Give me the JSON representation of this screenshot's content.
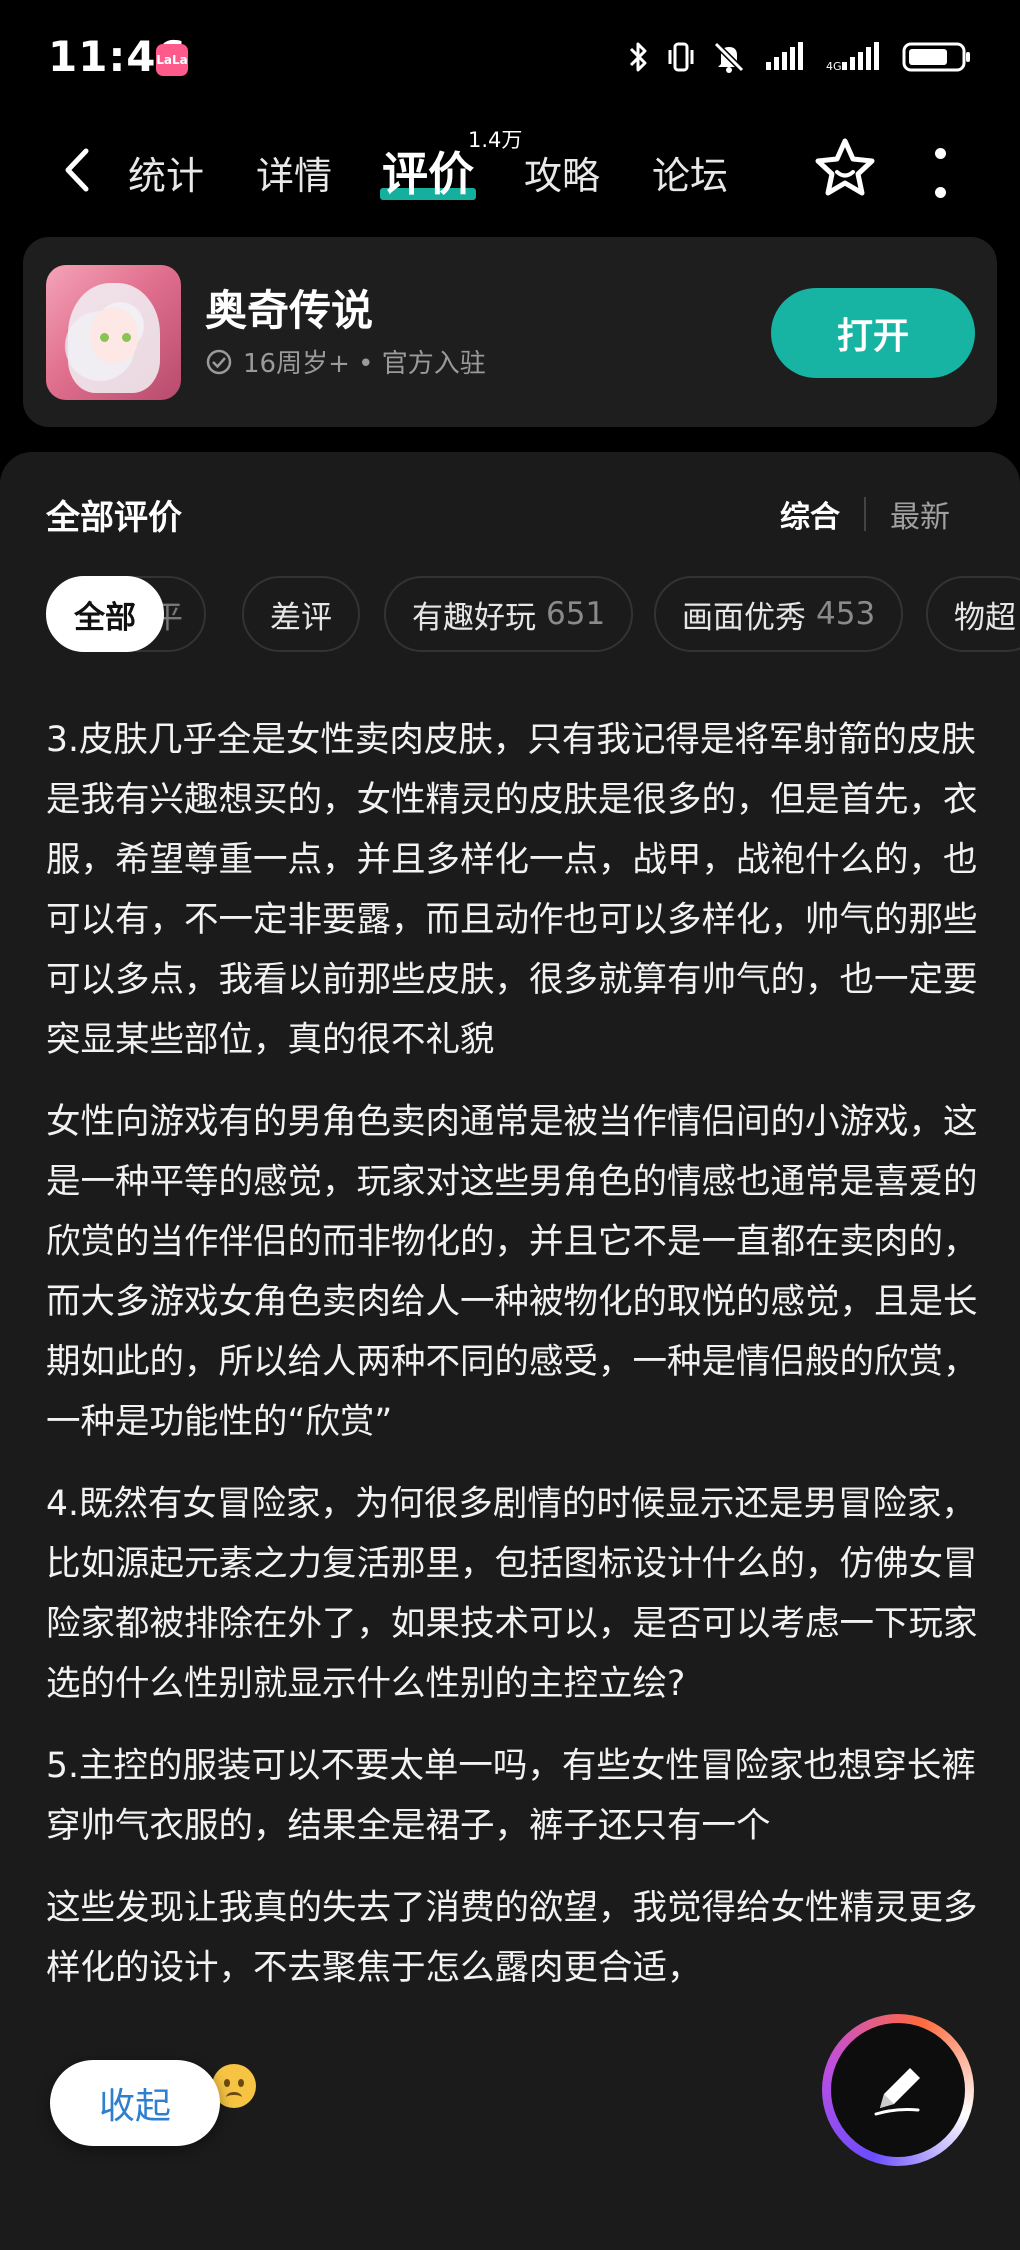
{
  "status_bar": {
    "time": "11:46",
    "app_badge": "LaLa",
    "battery_level": 0.75
  },
  "nav": {
    "tabs": [
      {
        "label": "统计"
      },
      {
        "label": "详情"
      },
      {
        "label": "评价",
        "count": "1.4万"
      },
      {
        "label": "攻略"
      },
      {
        "label": "论坛"
      }
    ],
    "active_tab": "评价",
    "accent": "#17b3a3"
  },
  "game": {
    "name": "奥奇传说",
    "meta": "16周岁+ • 官方入驻",
    "open_label": "打开"
  },
  "reviews": {
    "title": "全部评价",
    "sort": {
      "active": "综合",
      "other": "最新"
    },
    "chips": [
      {
        "label": "全部",
        "count": ""
      },
      {
        "label": "平",
        "count": ""
      },
      {
        "label": "差评",
        "count": ""
      },
      {
        "label": "有趣好玩",
        "count": "651"
      },
      {
        "label": "画面优秀",
        "count": "453"
      },
      {
        "label": "物超",
        "count": ""
      }
    ],
    "paragraphs": [
      "3.皮肤几乎全是女性卖肉皮肤，只有我记得是将军射箭的皮肤是我有兴趣想买的，女性精灵的皮肤是很多的，但是首先，衣服，希望尊重一点，并且多样化一点，战甲，战袍什么的，也可以有，不一定非要露，而且动作也可以多样化，帅气的那些可以多点，我看以前那些皮肤，很多就算有帅气的，也一定要突显某些部位，真的很不礼貌",
      "女性向游戏有的男角色卖肉通常是被当作情侣间的小游戏，这是一种平等的感觉，玩家对这些男角色的情感也通常是喜爱的欣赏的当作伴侣的而非物化的，并且它不是一直都在卖肉的，而大多游戏女角色卖肉给人一种被物化的取悦的感觉，且是长期如此的，所以给人两种不同的感受，一种是情侣般的欣赏，一种是功能性的“欣赏”",
      "4.既然有女冒险家，为何很多剧情的时候显示还是男冒险家，比如源起元素之力复活那里，包括图标设计什么的，仿佛女冒险家都被排除在外了，如果技术可以，是否可以考虑一下玩家选的什么性别就显示什么性别的主控立绘?",
      "5.主控的服装可以不要太单一吗，有些女性冒险家也想穿长裤穿帅气衣服的，结果全是裙子，裤子还只有一个",
      "这些发现让我真的失去了消费的欲望，我觉得给女性精灵更多样化的设计，不去聚焦于怎么露肉更合适，"
    ],
    "fold_label": "收起"
  }
}
